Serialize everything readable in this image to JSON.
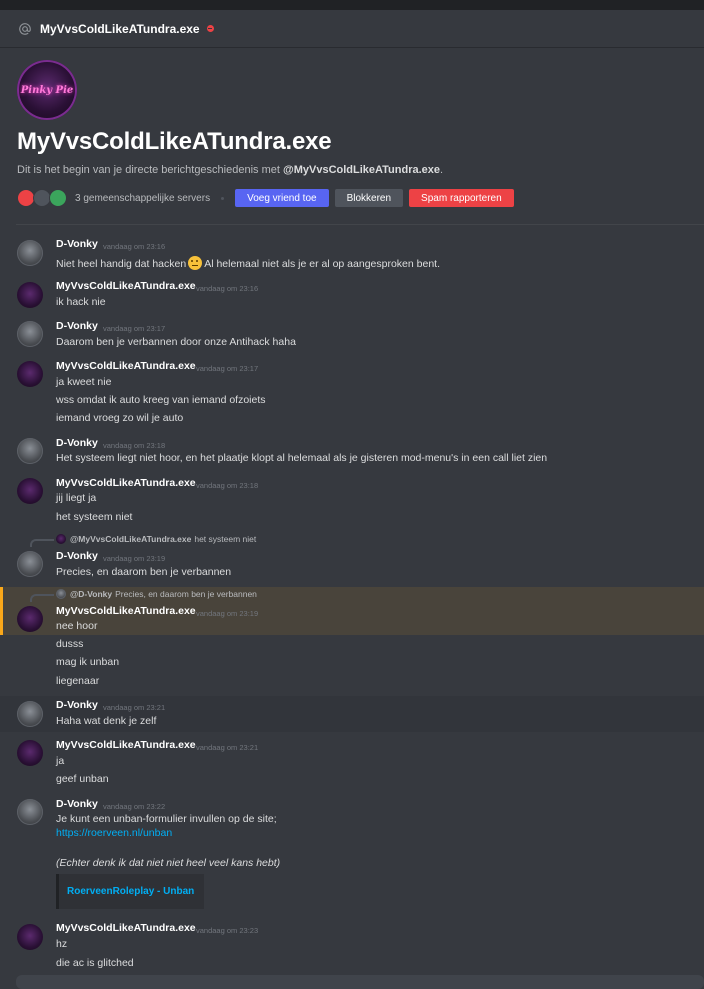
{
  "header": {
    "title": "MyVvsColdLikeATundra.exe",
    "icon": "at-icon",
    "status": "dnd"
  },
  "intro": {
    "avatar_text": "Pinky Pie",
    "name": "MyVvsColdLikeATundra.exe",
    "desc_prefix": "Dit is het begin van je directe berichtgeschiedenis met ",
    "desc_user": "@MyVvsColdLikeATundra.exe",
    "desc_suffix": ".",
    "mutual_servers": "3 gemeenschappelijke servers",
    "buttons": {
      "add_friend": "Voeg vriend toe",
      "block": "Blokkeren",
      "report": "Spam rapporteren"
    }
  },
  "messages": [
    {
      "user": "D-Vonky",
      "ts": "vandaag om 23:16",
      "lines": [
        "Niet heel handig dat hacken",
        "Al helemaal niet als je er al op aangesproken bent."
      ]
    },
    {
      "user": "MyVvsColdLikeATundra.exe",
      "ts": "vandaag om 23:16",
      "lines": [
        "ik hack nie"
      ]
    },
    {
      "user": "D-Vonky",
      "ts": "vandaag om 23:17",
      "lines": [
        "Daarom ben je verbannen door onze Antihack haha"
      ]
    },
    {
      "user": "MyVvsColdLikeATundra.exe",
      "ts": "vandaag om 23:17",
      "lines": [
        "ja kweet nie",
        "wss omdat ik auto kreeg van iemand ofzoiets",
        "iemand vroeg zo wil je auto"
      ]
    },
    {
      "user": "D-Vonky",
      "ts": "vandaag om 23:18",
      "lines": [
        "Het systeem liegt niet hoor, en het plaatje klopt al helemaal als je gisteren mod-menu's in een call liet zien"
      ]
    },
    {
      "user": "MyVvsColdLikeATundra.exe",
      "ts": "vandaag om 23:18",
      "lines": [
        "jij liegt ja",
        "het systeem niet"
      ]
    },
    {
      "user": "D-Vonky",
      "ts": "vandaag om 23:19",
      "reply_user": "@MyVvsColdLikeATundra.exe",
      "reply_text": "het systeem niet",
      "lines": [
        "Precies, en daarom ben je verbannen"
      ]
    },
    {
      "user": "MyVvsColdLikeATundra.exe",
      "ts": "vandaag om 23:19",
      "reply_user": "@D-Vonky",
      "reply_text": "Precies, en daarom ben je verbannen",
      "lines": [
        "nee hoor",
        "dusss",
        "mag ik unban",
        "liegenaar"
      ]
    },
    {
      "user": "D-Vonky",
      "ts": "vandaag om 23:21",
      "lines": [
        "Haha wat denk je zelf"
      ]
    },
    {
      "user": "MyVvsColdLikeATundra.exe",
      "ts": "vandaag om 23:21",
      "lines": [
        "ja",
        "geef unban"
      ]
    },
    {
      "user": "D-Vonky",
      "ts": "vandaag om 23:22",
      "lines": [
        "Je kunt een unban-formulier invullen op de site;",
        "https://roerveen.nl/unban",
        "(Echter denk ik dat niet niet heel veel kans hebt)"
      ],
      "embed_title": "RoerveenRoleplay - Unban"
    },
    {
      "user": "MyVvsColdLikeATundra.exe",
      "ts": "vandaag om 23:23",
      "lines": [
        "hz",
        "die ac is glitched"
      ]
    }
  ],
  "colors": {
    "background": "#36393f",
    "accent": "#5865f2",
    "danger": "#ed4245",
    "link": "#00aff4",
    "mention_highlight": "#faa81a"
  }
}
